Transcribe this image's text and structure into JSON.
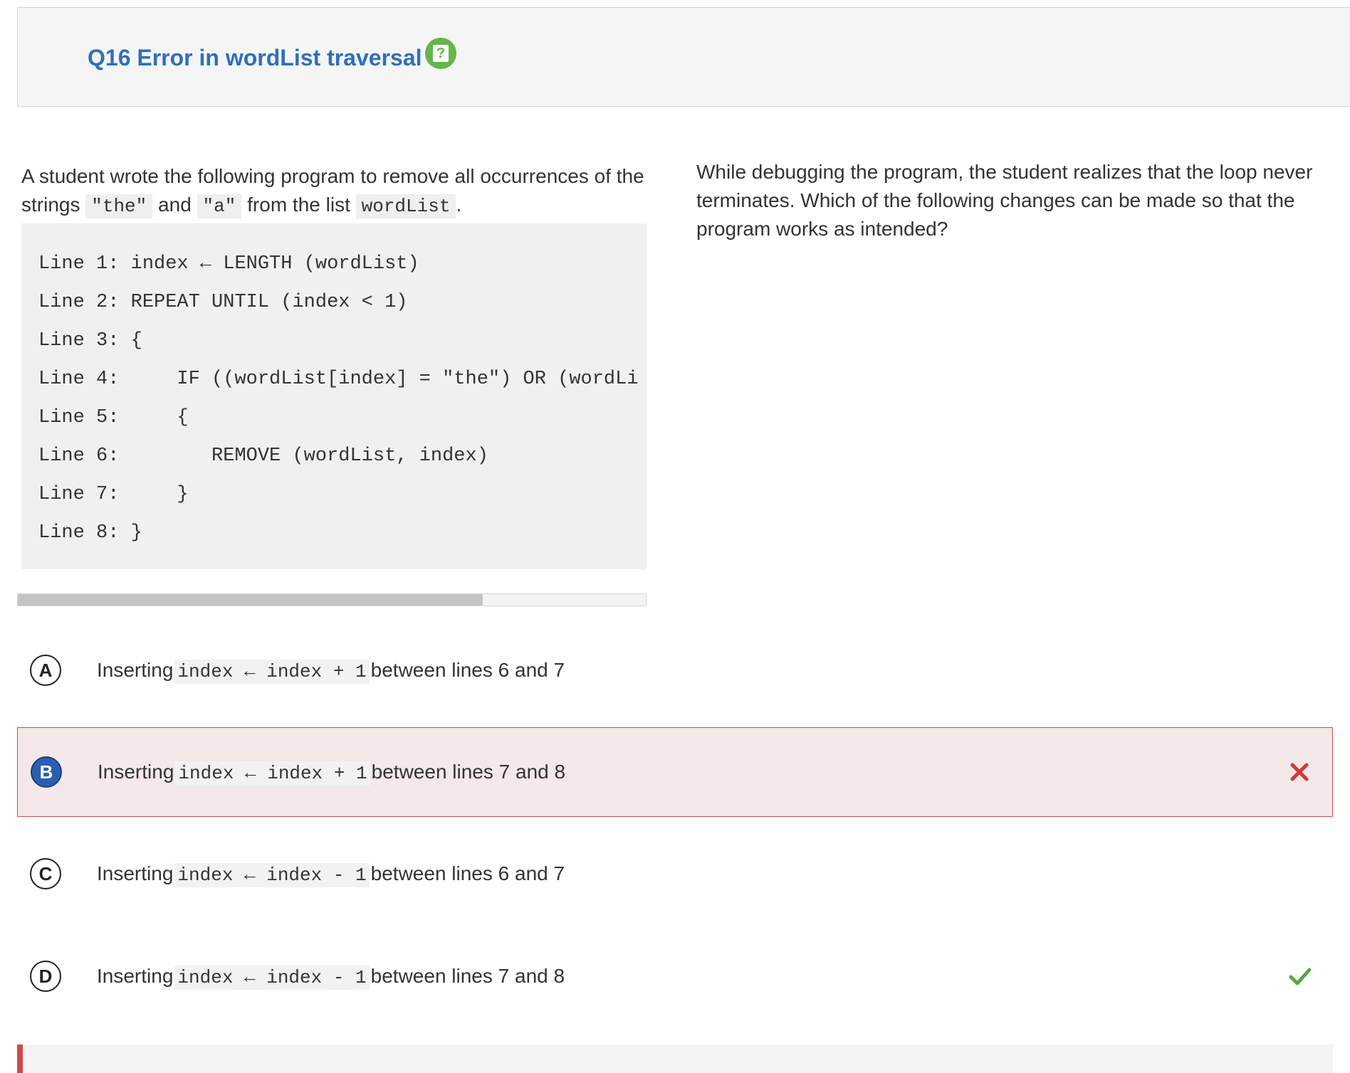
{
  "header": {
    "title": "Q16 Error in wordList traversal",
    "help_icon_glyph": "?"
  },
  "prompt": {
    "text_1": "A student wrote the following program to remove all occurrences of the strings ",
    "code_the": "\"the\"",
    "text_2": " and ",
    "code_a": "\"a\"",
    "text_3": " from the list ",
    "code_wordlist": "wordList",
    "text_4": "."
  },
  "code_lines": [
    "Line 1: index ← LENGTH (wordList)",
    "Line 2: REPEAT UNTIL (index < 1)",
    "Line 3: {",
    "Line 4:     IF ((wordList[index] = \"the\") OR (wordLi",
    "Line 5:     {",
    "Line 6:        REMOVE (wordList, index)",
    "Line 7:     }",
    "Line 8: }"
  ],
  "code_scroll_position": 0.74,
  "question": {
    "text": "While debugging the program, the student realizes that the loop never terminates. Which of the following changes can be made so that the program works as intended?"
  },
  "choices": [
    {
      "letter": "A",
      "prefix": "Inserting",
      "code": "index ← index + 1",
      "suffix": "between lines 6 and 7",
      "state": "none"
    },
    {
      "letter": "B",
      "prefix": "Inserting",
      "code": "index ← index + 1",
      "suffix": "between lines 7 and 8",
      "state": "selected-wrong"
    },
    {
      "letter": "C",
      "prefix": "Inserting",
      "code": "index ← index - 1",
      "suffix": "between lines 6 and 7",
      "state": "none"
    },
    {
      "letter": "D",
      "prefix": "Inserting",
      "code": "index ← index - 1",
      "suffix": "between lines 7 and 8",
      "state": "correct"
    }
  ],
  "colors": {
    "title": "#2f6fbd",
    "help_badge": "#65b648",
    "wrong_border": "#cf4a4a",
    "wrong_bg": "#f4e8e8",
    "selected_letter": "#2a5fb0",
    "wrong_mark": "#cf3a3a",
    "correct_mark": "#5aa545"
  },
  "icons": {
    "help": "help-icon",
    "wrong": "x-icon",
    "correct": "checkmark-icon"
  }
}
